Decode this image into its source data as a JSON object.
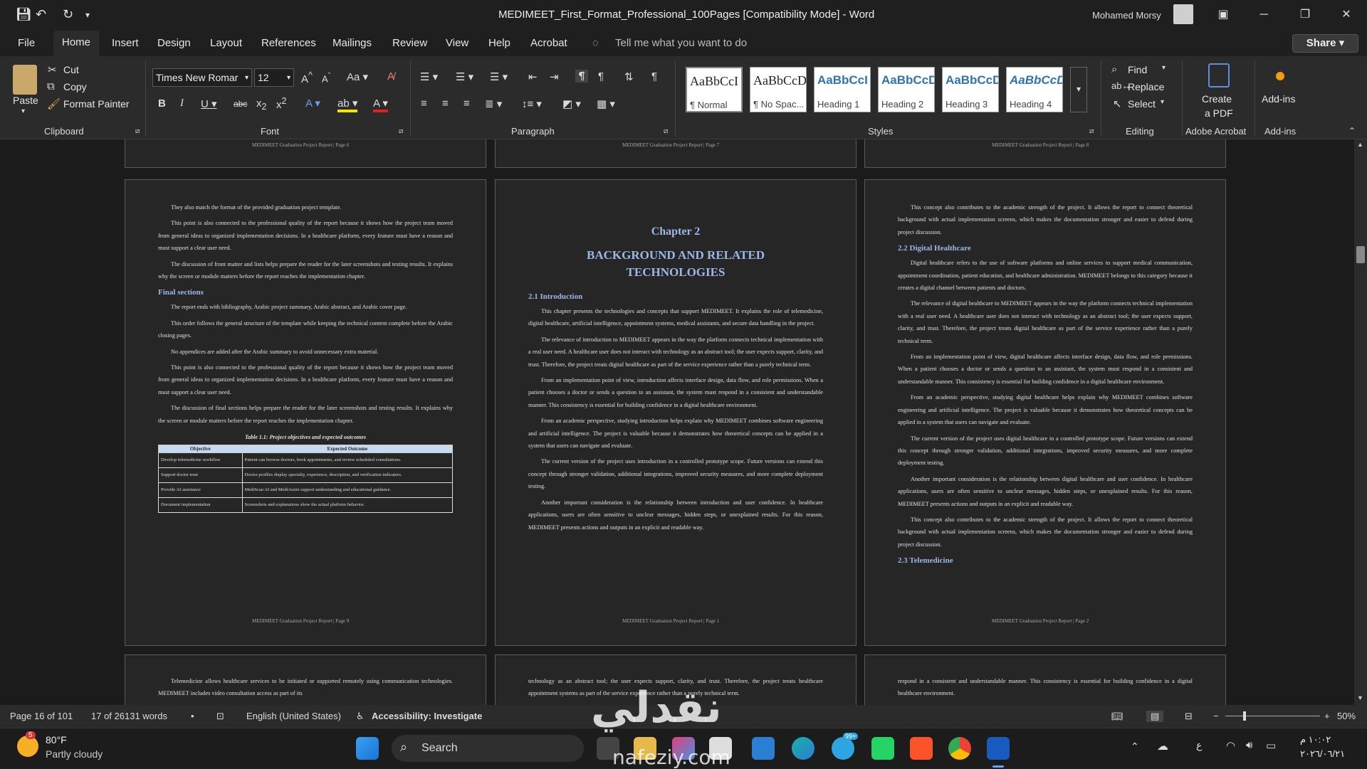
{
  "window": {
    "title": "MEDIMEET_First_Format_Professional_100Pages [Compatibility Mode]  -  Word",
    "user": "Mohamed Morsy"
  },
  "menu": {
    "tabs": [
      "File",
      "Home",
      "Insert",
      "Design",
      "Layout",
      "References",
      "Mailings",
      "Review",
      "View",
      "Help",
      "Acrobat"
    ],
    "tell_me": "Tell me what you want to do",
    "share": "Share"
  },
  "ribbon": {
    "clipboard": {
      "paste": "Paste",
      "cut": "Cut",
      "copy": "Copy",
      "format_painter": "Format Painter",
      "label": "Clipboard"
    },
    "font": {
      "name": "Times New Romar",
      "size": "12",
      "label": "Font"
    },
    "paragraph": {
      "label": "Paragraph"
    },
    "styles": {
      "label": "Styles",
      "items": [
        {
          "preview": "AaBbCcI",
          "name": "¶ Normal"
        },
        {
          "preview": "AaBbCcDc",
          "name": "¶ No Spac..."
        },
        {
          "preview": "AaBbCcI",
          "name": "Heading 1"
        },
        {
          "preview": "AaBbCcD",
          "name": "Heading 2"
        },
        {
          "preview": "AaBbCcD",
          "name": "Heading 3"
        },
        {
          "preview": "AaBbCcD",
          "name": "Heading 4"
        }
      ]
    },
    "editing": {
      "find": "Find",
      "replace": "Replace",
      "select": "Select",
      "label": "Editing"
    },
    "acrobat": {
      "create": "Create",
      "pdf": "a PDF",
      "label": "Adobe Acrobat"
    },
    "addins": {
      "button": "Add-ins",
      "label": "Add-ins"
    }
  },
  "pages": {
    "top_footers": [
      "MEDIMEET Graduation Project Report | Page 6",
      "MEDIMEET Graduation Project Report | Page 7",
      "MEDIMEET Graduation Project Report | Page 8"
    ],
    "left": {
      "p1": "They also match the format of the provided graduation project template.",
      "p2": "This point is also connected to the professional quality of the report because it shows how the project team moved from general ideas to organized implementation decisions. In a healthcare platform, every feature must have a reason and must support a clear user need.",
      "p3": "The discussion of front matter and lists helps prepare the reader for the later screenshots and testing results. It explains why the screen or module matters before the report reaches the implementation chapter.",
      "h1": "Final sections",
      "p4": "The report ends with bibliography, Arabic project summary, Arabic abstract, and Arabic cover page.",
      "p5": "This order follows the general structure of the template while keeping the technical content complete before the Arabic closing pages.",
      "p6": "No appendices are added after the Arabic summary to avoid unnecessary extra material.",
      "p7": "This point is also connected to the professional quality of the report because it shows how the project team moved from general ideas to organized implementation decisions. In a healthcare platform, every feature must have a reason and must support a clear user need.",
      "p8": "The discussion of final sections helps prepare the reader for the later screenshots and testing results. It explains why the screen or module matters before the report reaches the implementation chapter.",
      "table_caption": "Table 1.1: Project objectives and expected outcomes",
      "table_headers": [
        "Objective",
        "Expected Outcome"
      ],
      "table_rows": [
        [
          "Develop telemedicine workflow",
          "Patient can browse doctors, book appointments, and review scheduled consultations."
        ],
        [
          "Support doctor trust",
          "Doctor profiles display specialty, experience, description, and verification indicators."
        ],
        [
          "Provide AI assistance",
          "MediScan AI and MediAssist support understanding and educational guidance."
        ],
        [
          "Document implementation",
          "Screenshots and explanations show the actual platform behavior."
        ]
      ],
      "footer": "MEDIMEET Graduation Project Report | Page 9"
    },
    "middle": {
      "chapter": "Chapter 2",
      "chapter_title_1": "BACKGROUND AND RELATED",
      "chapter_title_2": "TECHNOLOGIES",
      "h1": "2.1 Introduction",
      "p1": "This chapter presents the technologies and concepts that support MEDIMEET. It explains the role of telemedicine, digital healthcare, artificial intelligence, appointment systems, medical assistants, and secure data handling in the project.",
      "p2": "The relevance of introduction to MEDIMEET appears in the way the platform connects technical implementation with a real user need. A healthcare user does not interact with technology as an abstract tool; the user expects support, clarity, and trust. Therefore, the project treats digital healthcare as part of the service experience rather than a purely technical term.",
      "p3": "From an implementation point of view, introduction affects interface design, data flow, and role permissions. When a patient chooses a doctor or sends a question to an assistant, the system must respond in a consistent and understandable manner. This consistency is essential for building confidence in a digital healthcare environment.",
      "p4": "From an academic perspective, studying introduction helps explain why MEDIMEET combines software engineering and artificial intelligence. The project is valuable because it demonstrates how theoretical concepts can be applied in a system that users can navigate and evaluate.",
      "p5": "The current version of the project uses introduction in a controlled prototype scope. Future versions can extend this concept through stronger validation, additional integrations, improved security measures, and more complete deployment testing.",
      "p6": "Another important consideration is the relationship between introduction and user confidence. In healthcare applications, users are often sensitive to unclear messages, hidden steps, or unexplained results. For this reason, MEDIMEET presents actions and outputs in an explicit and readable way.",
      "footer": "MEDIMEET Graduation Project Report | Page 1"
    },
    "right": {
      "p0": "This concept also contributes to the academic strength of the project. It allows the report to connect theoretical background with actual implementation screens, which makes the documentation stronger and easier to defend during project discussion.",
      "h1": "2.2 Digital Healthcare",
      "p1": "Digital healthcare refers to the use of software platforms and online services to support medical communication, appointment coordination, patient education, and healthcare administration. MEDIMEET belongs to this category because it creates a digital channel between patients and doctors.",
      "p2": "The relevance of digital healthcare to MEDIMEET appears in the way the platform connects technical implementation with a real user need. A healthcare user does not interact with technology as an abstract tool; the user expects support, clarity, and trust. Therefore, the project treats digital healthcare as part of the service experience rather than a purely technical term.",
      "p3": "From an implementation point of view, digital healthcare affects interface design, data flow, and role permissions. When a patient chooses a doctor or sends a question to an assistant, the system must respond in a consistent and understandable manner. This consistency is essential for building confidence in a digital healthcare environment.",
      "p4": "From an academic perspective, studying digital healthcare helps explain why MEDIMEET combines software engineering and artificial intelligence. The project is valuable because it demonstrates how theoretical concepts can be applied in a system that users can navigate and evaluate.",
      "p5": "The current version of the project uses digital healthcare in a controlled prototype scope. Future versions can extend this concept through stronger validation, additional integrations, improved security measures, and more complete deployment testing.",
      "p6": "Another important consideration is the relationship between digital healthcare and user confidence. In healthcare applications, users are often sensitive to unclear messages, hidden steps, or unexplained results. For this reason, MEDIMEET presents actions and outputs in an explicit and readable way.",
      "p7": "This concept also contributes to the academic strength of the project. It allows the report to connect theoretical background with actual implementation screens, which makes the documentation stronger and easier to defend during project discussion.",
      "h2": "2.3 Telemedicine",
      "footer": "MEDIMEET Graduation Project Report | Page 2"
    },
    "bottom": {
      "left": "Telemedicine allows healthcare services to be initiated or supported remotely using communication technologies. MEDIMEET includes video consultation access as part of its",
      "middle": "technology as an abstract tool; the user expects support, clarity, and trust. Therefore, the project treats healthcare appointment systems as part of the service experience rather than a purely technical term.",
      "right": "respond in a consistent and understandable manner. This consistency is essential for building confidence in a digital healthcare environment."
    }
  },
  "status": {
    "page": "Page 16 of 101",
    "words": "17 of 26131 words",
    "language": "English (United States)",
    "accessibility": "Accessibility: Investigate",
    "zoom": "50%"
  },
  "taskbar": {
    "weather_temp": "80°F",
    "weather_desc": "Partly cloudy",
    "weather_badge": "5",
    "search": "Search",
    "time": "١٠:٠٢ م",
    "date": "٢٠٢٦/٠٦/٢١",
    "lang": "ع",
    "telegram_badge": "99+"
  },
  "watermark": {
    "text": "نقدلي",
    "url": "nafeziy.com"
  },
  "colors": {
    "heading": "#9bb8e8",
    "table_header": "#c6d9f1",
    "word_blue": "#185abd"
  }
}
